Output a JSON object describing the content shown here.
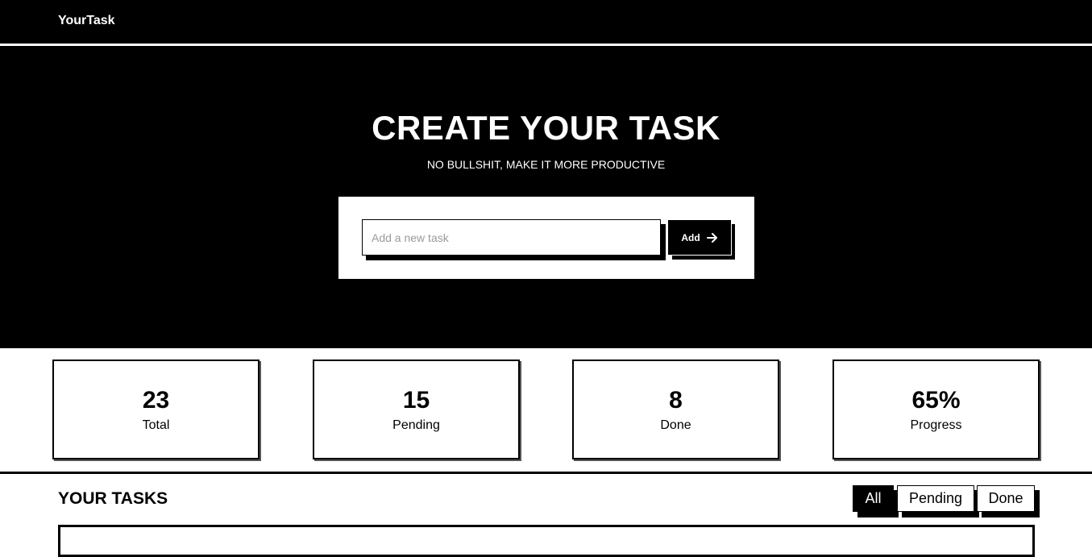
{
  "navbar": {
    "brand": "YourTask"
  },
  "hero": {
    "title": "CREATE YOUR TASK",
    "subtitle": "NO BULLSHIT, MAKE IT MORE PRODUCTIVE"
  },
  "task_form": {
    "input_placeholder": "Add a new task",
    "input_value": "",
    "add_label": "Add",
    "add_icon": "arrow-right-icon"
  },
  "stats": [
    {
      "value": "23",
      "label": "Total"
    },
    {
      "value": "15",
      "label": "Pending"
    },
    {
      "value": "8",
      "label": "Done"
    },
    {
      "value": "65%",
      "label": "Progress"
    }
  ],
  "tasks_section": {
    "title": "YOUR TASKS",
    "filters": [
      {
        "label": "All",
        "active": true
      },
      {
        "label": "Pending",
        "active": false
      },
      {
        "label": "Done",
        "active": false
      }
    ]
  },
  "colors": {
    "background": "#000000",
    "foreground": "#ffffff"
  }
}
